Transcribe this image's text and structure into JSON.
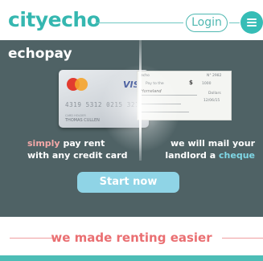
{
  "header": {
    "logo": "cityecho",
    "login_label": "Login",
    "accent_color": "#35b7b0",
    "menu_icon": "hamburger-menu-icon"
  },
  "hero": {
    "brand": "echopay",
    "background_color": "#4f6265",
    "card": {
      "network": "MasterCard",
      "brand": "VISA",
      "number": "4319 5312 0215 3216",
      "holder_caption": "CARD HOLDER",
      "holder": "THOMAS CULLEN"
    },
    "cheque": {
      "number": "N° 2982",
      "payee_caption": "Pay to the",
      "payee": "Homeland",
      "currency": "$",
      "amount": "1000",
      "amount_words": "Dollars",
      "date": "12/06/15",
      "header": "echo"
    },
    "left_tagline": {
      "highlight": "simply",
      "rest_line1": " pay rent",
      "line2": "with any credit card"
    },
    "right_tagline": {
      "line1": "we will mail your",
      "line2_prefix": "landlord a ",
      "highlight": "cheque"
    },
    "cta_label": "Start now"
  },
  "section": {
    "heading": "we made renting easier"
  }
}
